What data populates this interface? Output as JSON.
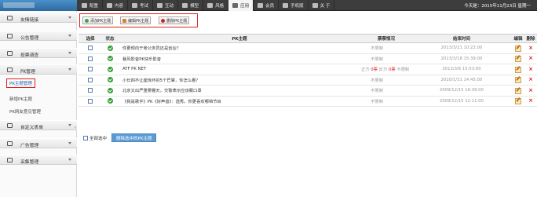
{
  "topbar": {
    "nav": [
      {
        "label": "配置",
        "icon": "gear-icon"
      },
      {
        "label": "内容",
        "icon": "content-icon"
      },
      {
        "label": "考试",
        "icon": "exam-icon"
      },
      {
        "label": "互动",
        "icon": "interact-icon"
      },
      {
        "label": "模型",
        "icon": "model-icon"
      },
      {
        "label": "风格",
        "icon": "style-icon"
      },
      {
        "label": "应用",
        "icon": "app-icon"
      },
      {
        "label": "会员",
        "icon": "member-icon"
      },
      {
        "label": "手机版",
        "icon": "mobile-icon"
      },
      {
        "label": "关 于",
        "icon": "about-icon"
      }
    ],
    "active_index": 6,
    "datetime": "今天是：2015年11月23日 星期一"
  },
  "sidebar": {
    "groups": [
      {
        "label": "友情链接",
        "icon": "link-icon"
      },
      {
        "label": "公告管理",
        "icon": "notice-icon"
      },
      {
        "label": "投票调查",
        "icon": "vote-icon"
      },
      {
        "label": "PK管理",
        "icon": "pk-icon"
      },
      {
        "label": "自定义表单",
        "icon": "form-icon"
      },
      {
        "label": "广告管理",
        "icon": "ad-icon"
      },
      {
        "label": "采集管理",
        "icon": "collect-icon"
      }
    ],
    "pk_subitems": [
      "PK主题管理",
      "新增PK主题",
      "PK网友意见管理"
    ]
  },
  "toolbar": {
    "add_label": "添加PK主题",
    "edit_label": "编辑PK主题",
    "delete_label": "删除PK主题"
  },
  "table": {
    "headers": {
      "select": "选择",
      "status": "状态",
      "topic": "PK主题",
      "vote": "票票情况",
      "endtime": "结束时间",
      "edit": "编辑",
      "delete": "删除"
    },
    "rows": [
      {
        "topic": "你更倾向于考公务员还是创业？",
        "vote": "不限制",
        "endtime": "2013/3/21 10:22:00"
      },
      {
        "topic": "暴风影音PK快乐影音",
        "vote": "不限制",
        "endtime": "2013/3/18 15:39:00"
      },
      {
        "topic": "ATF PK NET",
        "vote_parts": {
          "pro_label": "正方",
          "pro": "0票",
          "con_label": "反方",
          "con": "0票",
          "limit": "不限制"
        },
        "endtime": "2013/3/6 15:53:00"
      },
      {
        "topic": "小长四不让座惊坏的5个巴掌，你怎么看？",
        "vote": "不限制",
        "endtime": "2010/1/31 14:45:00"
      },
      {
        "topic": "北京又出严重雾霾天，交警表示应该戴口罩",
        "vote": "不限制",
        "endtime": "2009/12/15 16:39:00"
      },
      {
        "topic": "《我是歌手》PK《好声音》：选秀，你更喜欢哪档节目",
        "vote": "不限制",
        "endtime": "2009/12/15 12:11:00"
      }
    ]
  },
  "footer": {
    "select_all": "全部选中",
    "delete_selected": "删除选中的PK主题"
  }
}
